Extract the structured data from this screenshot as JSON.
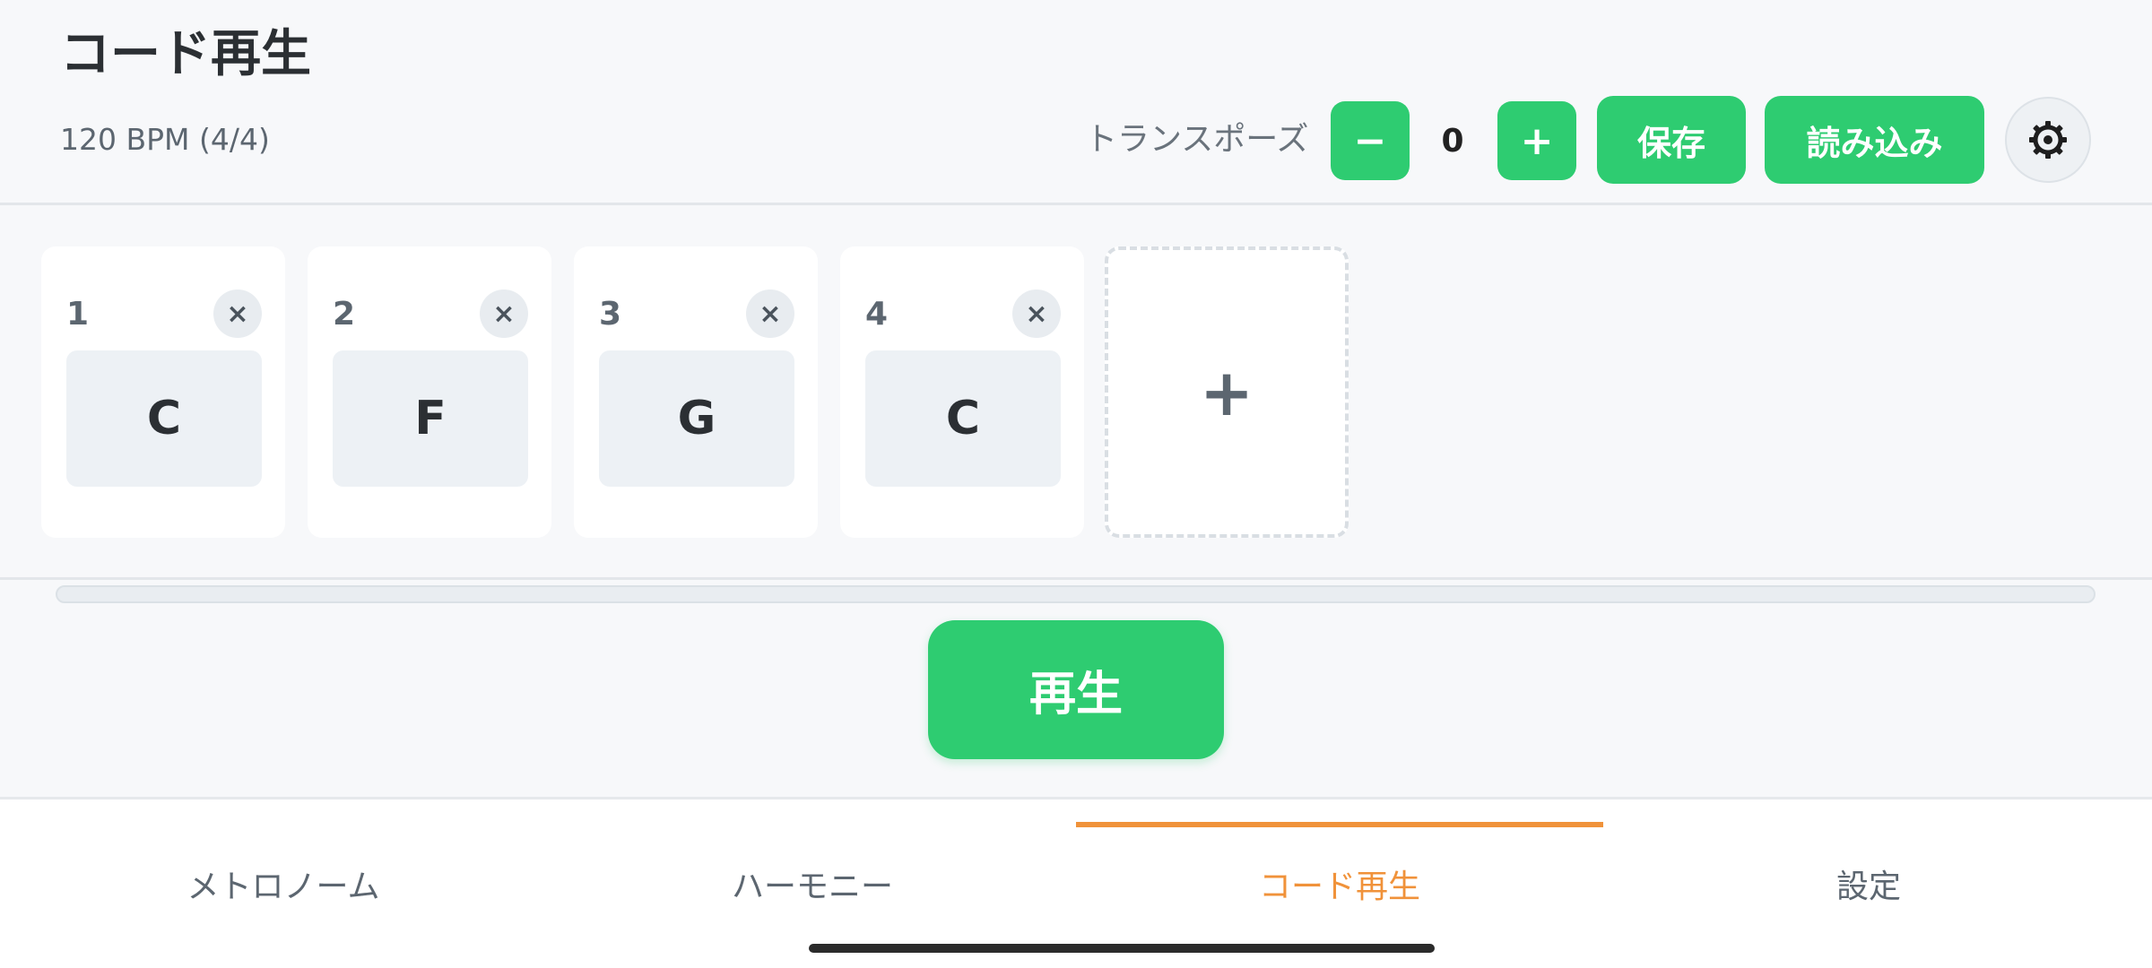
{
  "header": {
    "title": "コード再生",
    "bpm_text": "120 BPM (4/4)",
    "transpose_label": "トランスポーズ",
    "transpose_minus": "−",
    "transpose_value": "0",
    "transpose_plus": "+",
    "save_label": "保存",
    "load_label": "読み込み",
    "settings_icon": "gear-icon"
  },
  "chords": [
    {
      "number": "1",
      "name": "C",
      "remove": "×"
    },
    {
      "number": "2",
      "name": "F",
      "remove": "×"
    },
    {
      "number": "3",
      "name": "G",
      "remove": "×"
    },
    {
      "number": "4",
      "name": "C",
      "remove": "×"
    }
  ],
  "add_chord_label": "+",
  "progress": 0,
  "play_label": "再生",
  "tabs": [
    {
      "label": "メトロノーム",
      "active": false
    },
    {
      "label": "ハーモニー",
      "active": false
    },
    {
      "label": "コード再生",
      "active": true
    },
    {
      "label": "設定",
      "active": false
    }
  ],
  "colors": {
    "accent_green": "#2ecc71",
    "active_tab": "#f0923a",
    "background": "#f7f8fa"
  }
}
